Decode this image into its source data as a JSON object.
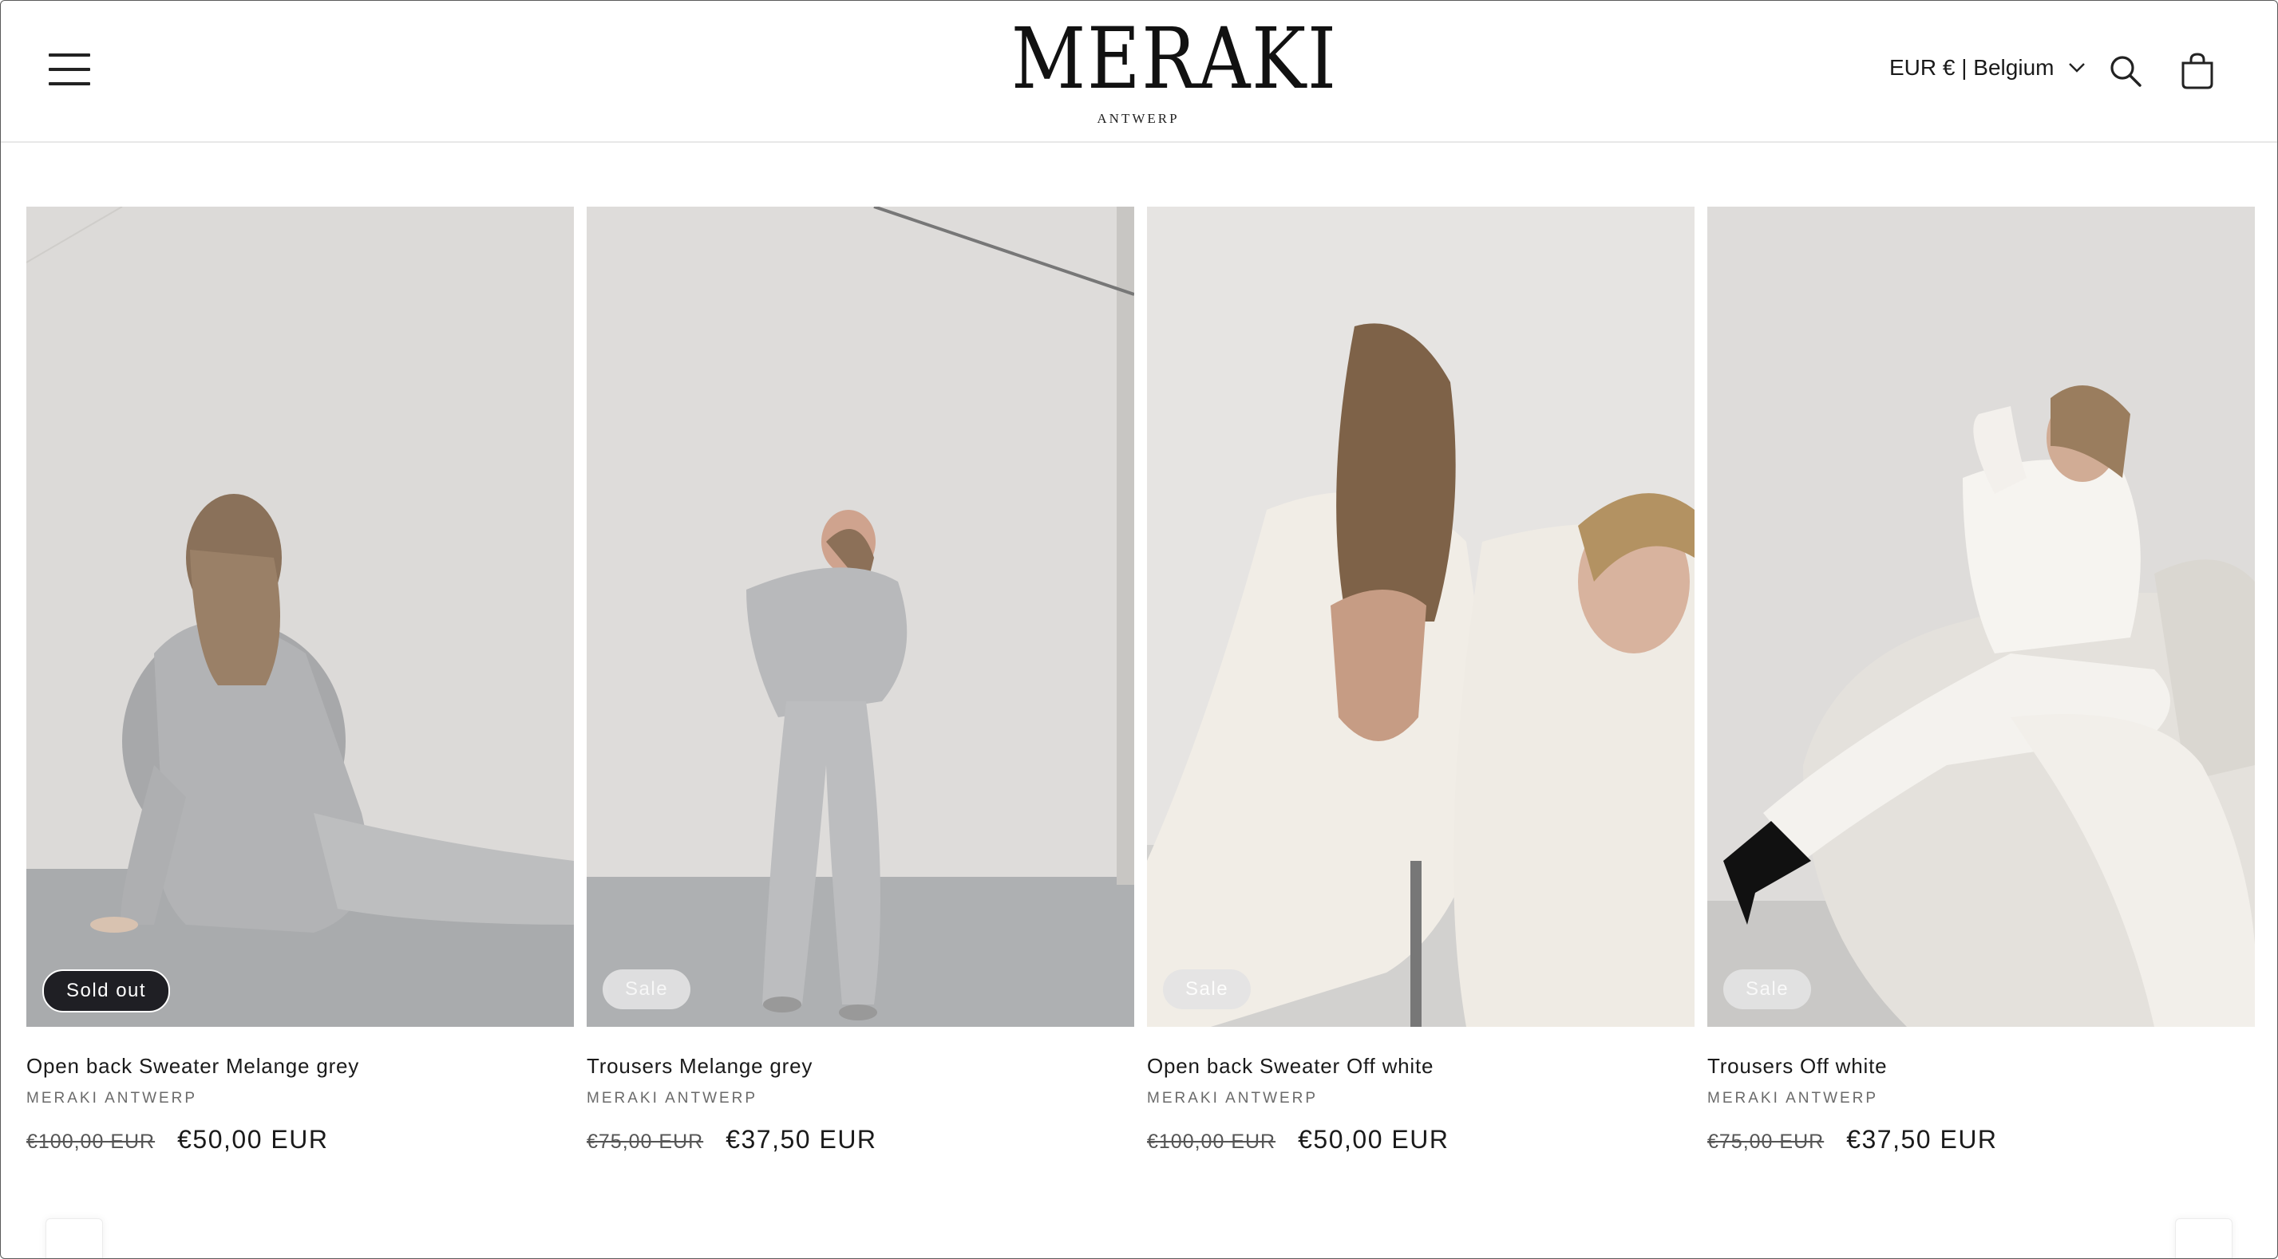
{
  "header": {
    "logo_text": "MERAKI",
    "logo_sub": "ANTWERP",
    "locale_label": "EUR € | Belgium",
    "icons": {
      "menu": "hamburger-menu-icon",
      "search": "search-icon",
      "cart": "shopping-bag-icon",
      "chevron": "chevron-down-icon"
    }
  },
  "products": [
    {
      "badge": "Sold out",
      "badge_style": "dark",
      "title": "Open back Sweater Melange grey",
      "vendor": "MERAKI ANTWERP",
      "price_old": "€100,00 EUR",
      "price_new": "€50,00 EUR",
      "tone": "grey"
    },
    {
      "badge": "Sale",
      "badge_style": "light",
      "title": "Trousers Melange grey",
      "vendor": "MERAKI ANTWERP",
      "price_old": "€75,00 EUR",
      "price_new": "€37,50 EUR",
      "tone": "grey"
    },
    {
      "badge": "Sale",
      "badge_style": "light",
      "title": "Open back Sweater Off white",
      "vendor": "MERAKI ANTWERP",
      "price_old": "€100,00 EUR",
      "price_new": "€50,00 EUR",
      "tone": "white"
    },
    {
      "badge": "Sale",
      "badge_style": "light",
      "title": "Trousers Off white",
      "vendor": "MERAKI ANTWERP",
      "price_old": "€75,00 EUR",
      "price_new": "€37,50 EUR",
      "tone": "white"
    }
  ],
  "colors": {
    "text": "#121212",
    "badge_dark": "#1f1f24",
    "badge_light": "#e4e4e4",
    "wall": "#dddbd8",
    "floor_grey": "#a9abad"
  }
}
